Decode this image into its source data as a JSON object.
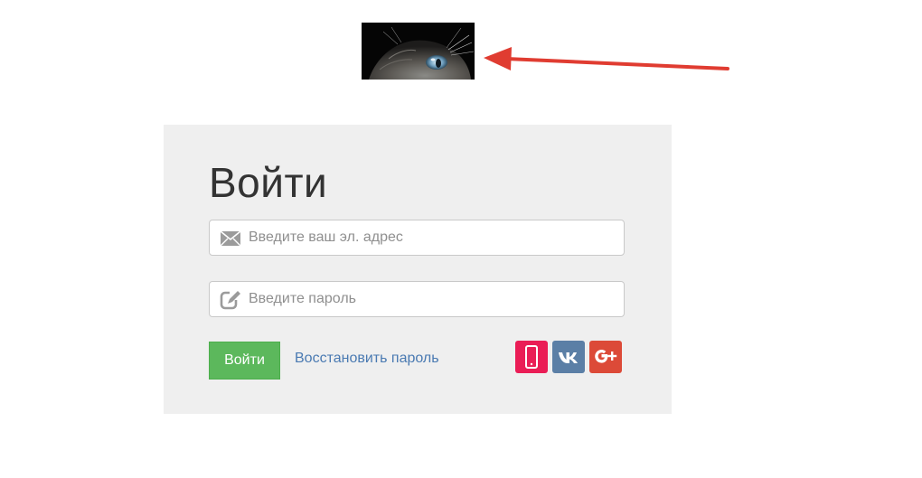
{
  "header": {
    "logo_icon": "cat-photo",
    "annotation_icon": "arrow-left-icon",
    "annotation_color": "#e03c31"
  },
  "login": {
    "title": "Войти",
    "email": {
      "value": "",
      "placeholder": "Введите ваш эл. адрес",
      "icon": "envelope-icon"
    },
    "password": {
      "value": "",
      "placeholder": "Введите пароль",
      "icon": "edit-icon"
    },
    "submit_label": "Войти",
    "forgot_link": "Восстановить пароль",
    "social": [
      {
        "name": "phone",
        "icon": "phone-icon",
        "color": "#ea1d56"
      },
      {
        "name": "vk",
        "icon": "vk-icon",
        "label": "VK",
        "color": "#5b7fa6"
      },
      {
        "name": "google-plus",
        "icon": "google-plus-icon",
        "label": "G+",
        "color": "#dc4a38"
      }
    ]
  },
  "colors": {
    "panel_bg": "#efefef",
    "submit_bg": "#5cb85c",
    "link": "#4a7ab2"
  }
}
